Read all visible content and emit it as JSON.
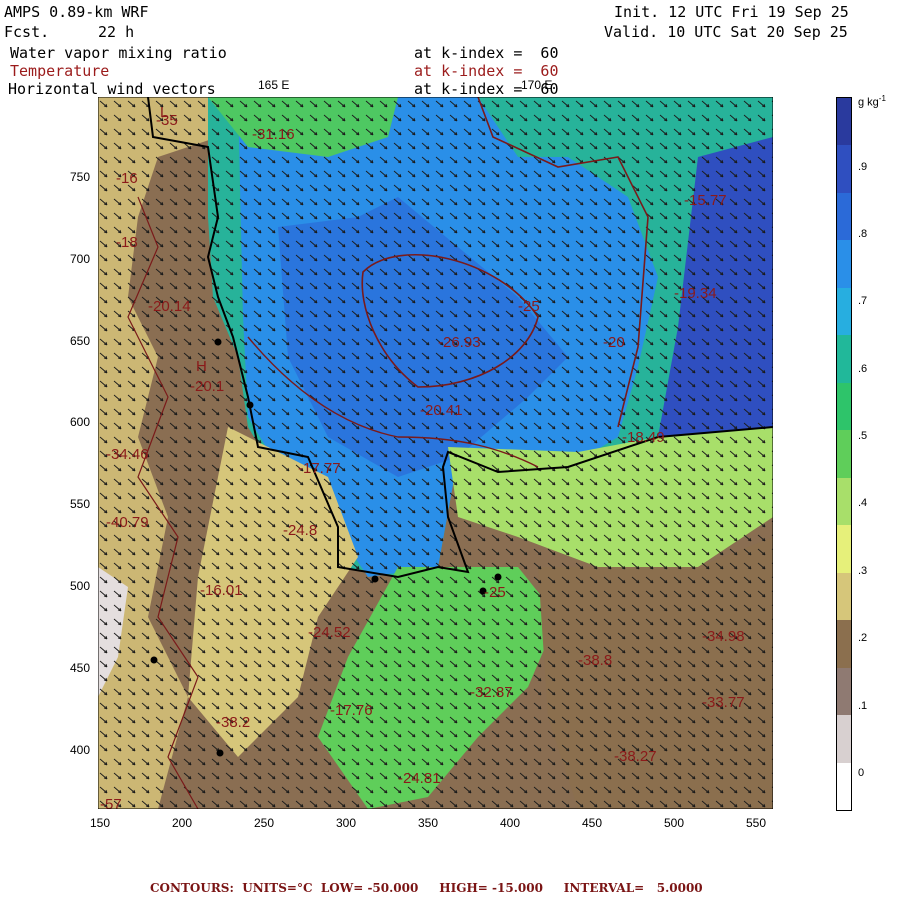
{
  "header": {
    "model": "AMPS 0.89-km WRF",
    "fcst_label": "Fcst.",
    "fcst_value": "22 h",
    "init": "Init. 12 UTC Fri 19 Sep 25",
    "valid": "Valid. 10 UTC Sat 20 Sep 25",
    "field1": "Water vapor mixing ratio",
    "field2": "Temperature",
    "field3": "Horizontal wind vectors",
    "k1": "at k-index =  60",
    "k2": "at k-index =  60",
    "k3": "at k-index =  60",
    "lon_165": "165 E",
    "lon_170": "170 E"
  },
  "axes": {
    "x_ticks": [
      "150",
      "200",
      "250",
      "300",
      "350",
      "400",
      "450",
      "500",
      "550"
    ],
    "y_ticks": [
      "750",
      "700",
      "650",
      "600",
      "550",
      "500",
      "450",
      "400"
    ]
  },
  "colorbar": {
    "unit": "g kg",
    "unit_sup": "-1",
    "labels": [
      ".9",
      ".8",
      ".7",
      ".6",
      ".5",
      ".4",
      ".3",
      ".2",
      ".1",
      "0"
    ],
    "colors": [
      "#2a3a9e",
      "#2f4fc0",
      "#2b6ad8",
      "#2a8fe8",
      "#27aee0",
      "#21b89a",
      "#2ec46a",
      "#5fce5a",
      "#a8df6a",
      "#e6f07a",
      "#d6c67a",
      "#8b6f4e",
      "#8f7a72",
      "#d8d0d0",
      "#ffffff"
    ]
  },
  "map_labels": [
    {
      "t": "-35"
    },
    {
      "t": "-31.16"
    },
    {
      "t": "L"
    },
    {
      "t": "-16"
    },
    {
      "t": "-18"
    },
    {
      "t": "-20.14"
    },
    {
      "t": "H"
    },
    {
      "t": "-20.1"
    },
    {
      "t": "-34.46"
    },
    {
      "t": "-40.79"
    },
    {
      "t": "-24.8"
    },
    {
      "t": "-16.01"
    },
    {
      "t": "-24.52"
    },
    {
      "t": "-17.76"
    },
    {
      "t": "-38.2"
    },
    {
      "t": "-24.81"
    },
    {
      "t": "-32.87"
    },
    {
      "t": "-38.8"
    },
    {
      "t": "-34.98"
    },
    {
      "t": "-33.77"
    },
    {
      "t": "-38.27"
    },
    {
      "t": "-26.93"
    },
    {
      "t": "-25"
    },
    {
      "t": "-20.41"
    },
    {
      "t": "-20"
    },
    {
      "t": "-18.49"
    },
    {
      "t": "-15.77"
    },
    {
      "t": "-19.34"
    },
    {
      "t": "-17.77"
    },
    {
      "t": "-25"
    },
    {
      "t": "-57"
    }
  ],
  "footer": "CONTOURS:  UNITS=°C  LOW= -50.000     HIGH= -15.000     INTERVAL=   5.0000"
}
